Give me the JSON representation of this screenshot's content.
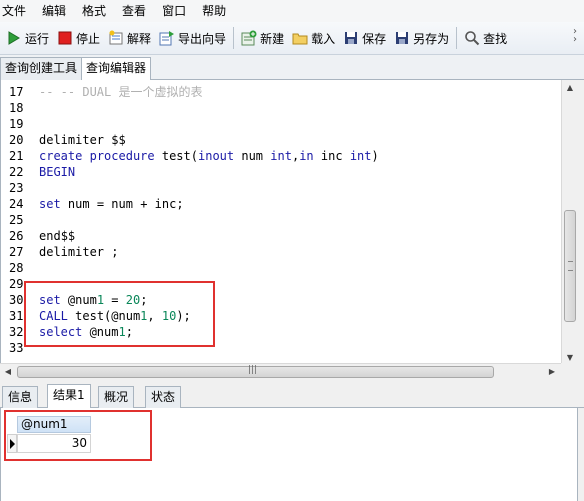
{
  "menu": [
    "文件",
    "编辑",
    "格式",
    "查看",
    "窗口",
    "帮助"
  ],
  "toolbar": {
    "run": "运行",
    "stop": "停止",
    "explain": "解释",
    "export_wizard": "导出向导",
    "new": "新建",
    "load": "载入",
    "save": "保存",
    "save_as": "另存为",
    "find": "查找"
  },
  "tabs": [
    "查询创建工具",
    "查询编辑器"
  ],
  "editor": {
    "lines": [
      {
        "n": "17",
        "text": "-- -- DUAL 是一个虚拟的表"
      },
      {
        "n": "18",
        "text": ""
      },
      {
        "n": "19",
        "text": ""
      },
      {
        "n": "20",
        "text": "delimiter $$"
      },
      {
        "n": "21",
        "text": "create procedure test(inout num int,in inc int)"
      },
      {
        "n": "22",
        "text": "BEGIN"
      },
      {
        "n": "23",
        "text": ""
      },
      {
        "n": "24",
        "text": "set num = num + inc;"
      },
      {
        "n": "25",
        "text": ""
      },
      {
        "n": "26",
        "text": "end$$"
      },
      {
        "n": "27",
        "text": "delimiter ;"
      },
      {
        "n": "28",
        "text": ""
      },
      {
        "n": "29",
        "text": ""
      },
      {
        "n": "30",
        "text": "set @num1 = 20;"
      },
      {
        "n": "31",
        "text": "CALL test(@num1, 10);"
      },
      {
        "n": "32",
        "text": "select @num1;"
      },
      {
        "n": "33",
        "text": ""
      }
    ]
  },
  "result_tabs": [
    "信息",
    "结果1",
    "概况",
    "状态"
  ],
  "result_grid": {
    "column": "@num1",
    "value": "30"
  }
}
